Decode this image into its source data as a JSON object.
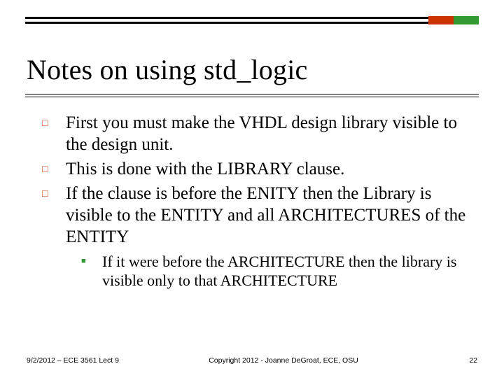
{
  "decor": {
    "accent_colors": [
      "#cc3300",
      "#339933"
    ]
  },
  "title": "Notes on using std_logic",
  "bullets": [
    {
      "text": "First you must make the VHDL design library visible to the design unit."
    },
    {
      "text": "This is done with the LIBRARY clause."
    },
    {
      "text": "If the clause is before the ENITY then the Library is visible to the ENTITY and all ARCHITECTURES of the ENTITY"
    }
  ],
  "subbullets": [
    {
      "text": "If it were before the ARCHITECTURE then the library is visible only to that ARCHITECTURE"
    }
  ],
  "footer": {
    "left": "9/2/2012 – ECE 3561 Lect 9",
    "center": "Copyright 2012 - Joanne DeGroat, ECE, OSU",
    "right": "22"
  }
}
